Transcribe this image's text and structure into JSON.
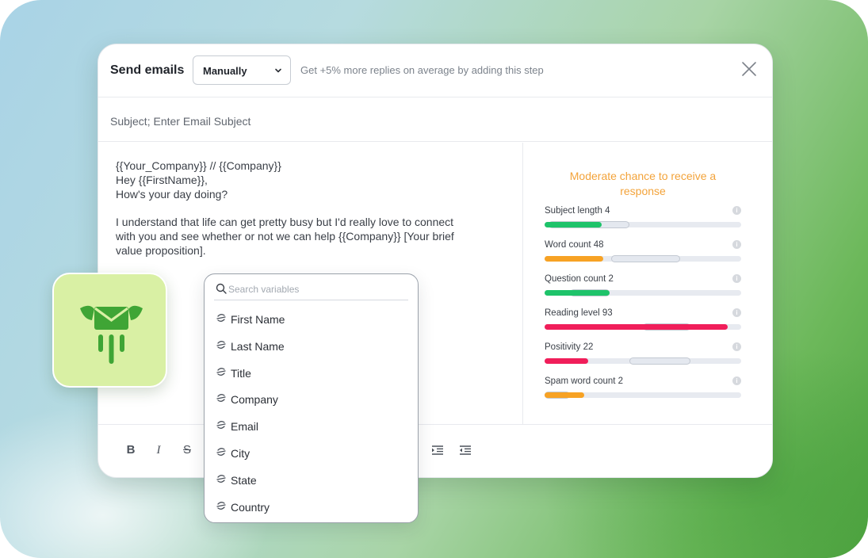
{
  "dialog": {
    "title": "Send emails",
    "mode_select": {
      "value": "Manually"
    },
    "hint": "Get +5% more replies on average by adding this step",
    "close_icon": "close-icon"
  },
  "subject": {
    "text": "Subject; Enter Email Subject"
  },
  "body": {
    "lines": [
      "{{Your_Company}} // {{Company}}",
      "Hey {{FirstName}},",
      "How's your day doing?",
      "I understand that life can get pretty busy but I'd really love to connect",
      "with you and see whether or not we can help {{Company}} [Your brief",
      "value proposition]."
    ]
  },
  "score": {
    "title": "Moderate chance to receive a response",
    "metrics": [
      {
        "label": "Subject length 4",
        "fill": 0.29,
        "color": "#1ec36a",
        "ghost": [
          0.02,
          0.43
        ]
      },
      {
        "label": "Word count 48",
        "fill": 0.3,
        "color": "#f7a224",
        "ghost": [
          0.34,
          0.69
        ]
      },
      {
        "label": "Question count 2",
        "fill": 0.33,
        "color": "#1ec36a",
        "ghost": [
          0.13,
          0.33
        ]
      },
      {
        "label": "Reading level 93",
        "fill": 0.93,
        "color": "#f01e5a",
        "ghost": [
          0.5,
          0.74
        ]
      },
      {
        "label": "Positivity 22",
        "fill": 0.22,
        "color": "#f01e5a",
        "ghost": [
          0.43,
          0.74
        ]
      },
      {
        "label": "Spam word count 2",
        "fill": 0.2,
        "color": "#f7a224",
        "ghost": [
          0.0,
          0.13
        ]
      }
    ]
  },
  "toolbar": {
    "bold": "B",
    "italic": "I",
    "strike": "S"
  },
  "variables": {
    "search_placeholder": "Search variables",
    "items": [
      "First Name",
      "Last Name",
      "Title",
      "Company",
      "Email",
      "City",
      "State",
      "Country"
    ]
  },
  "colors": {
    "accent_orange": "#f3a33a",
    "logo_green": "#3fa535",
    "logo_bg": "#d9f0a4"
  }
}
